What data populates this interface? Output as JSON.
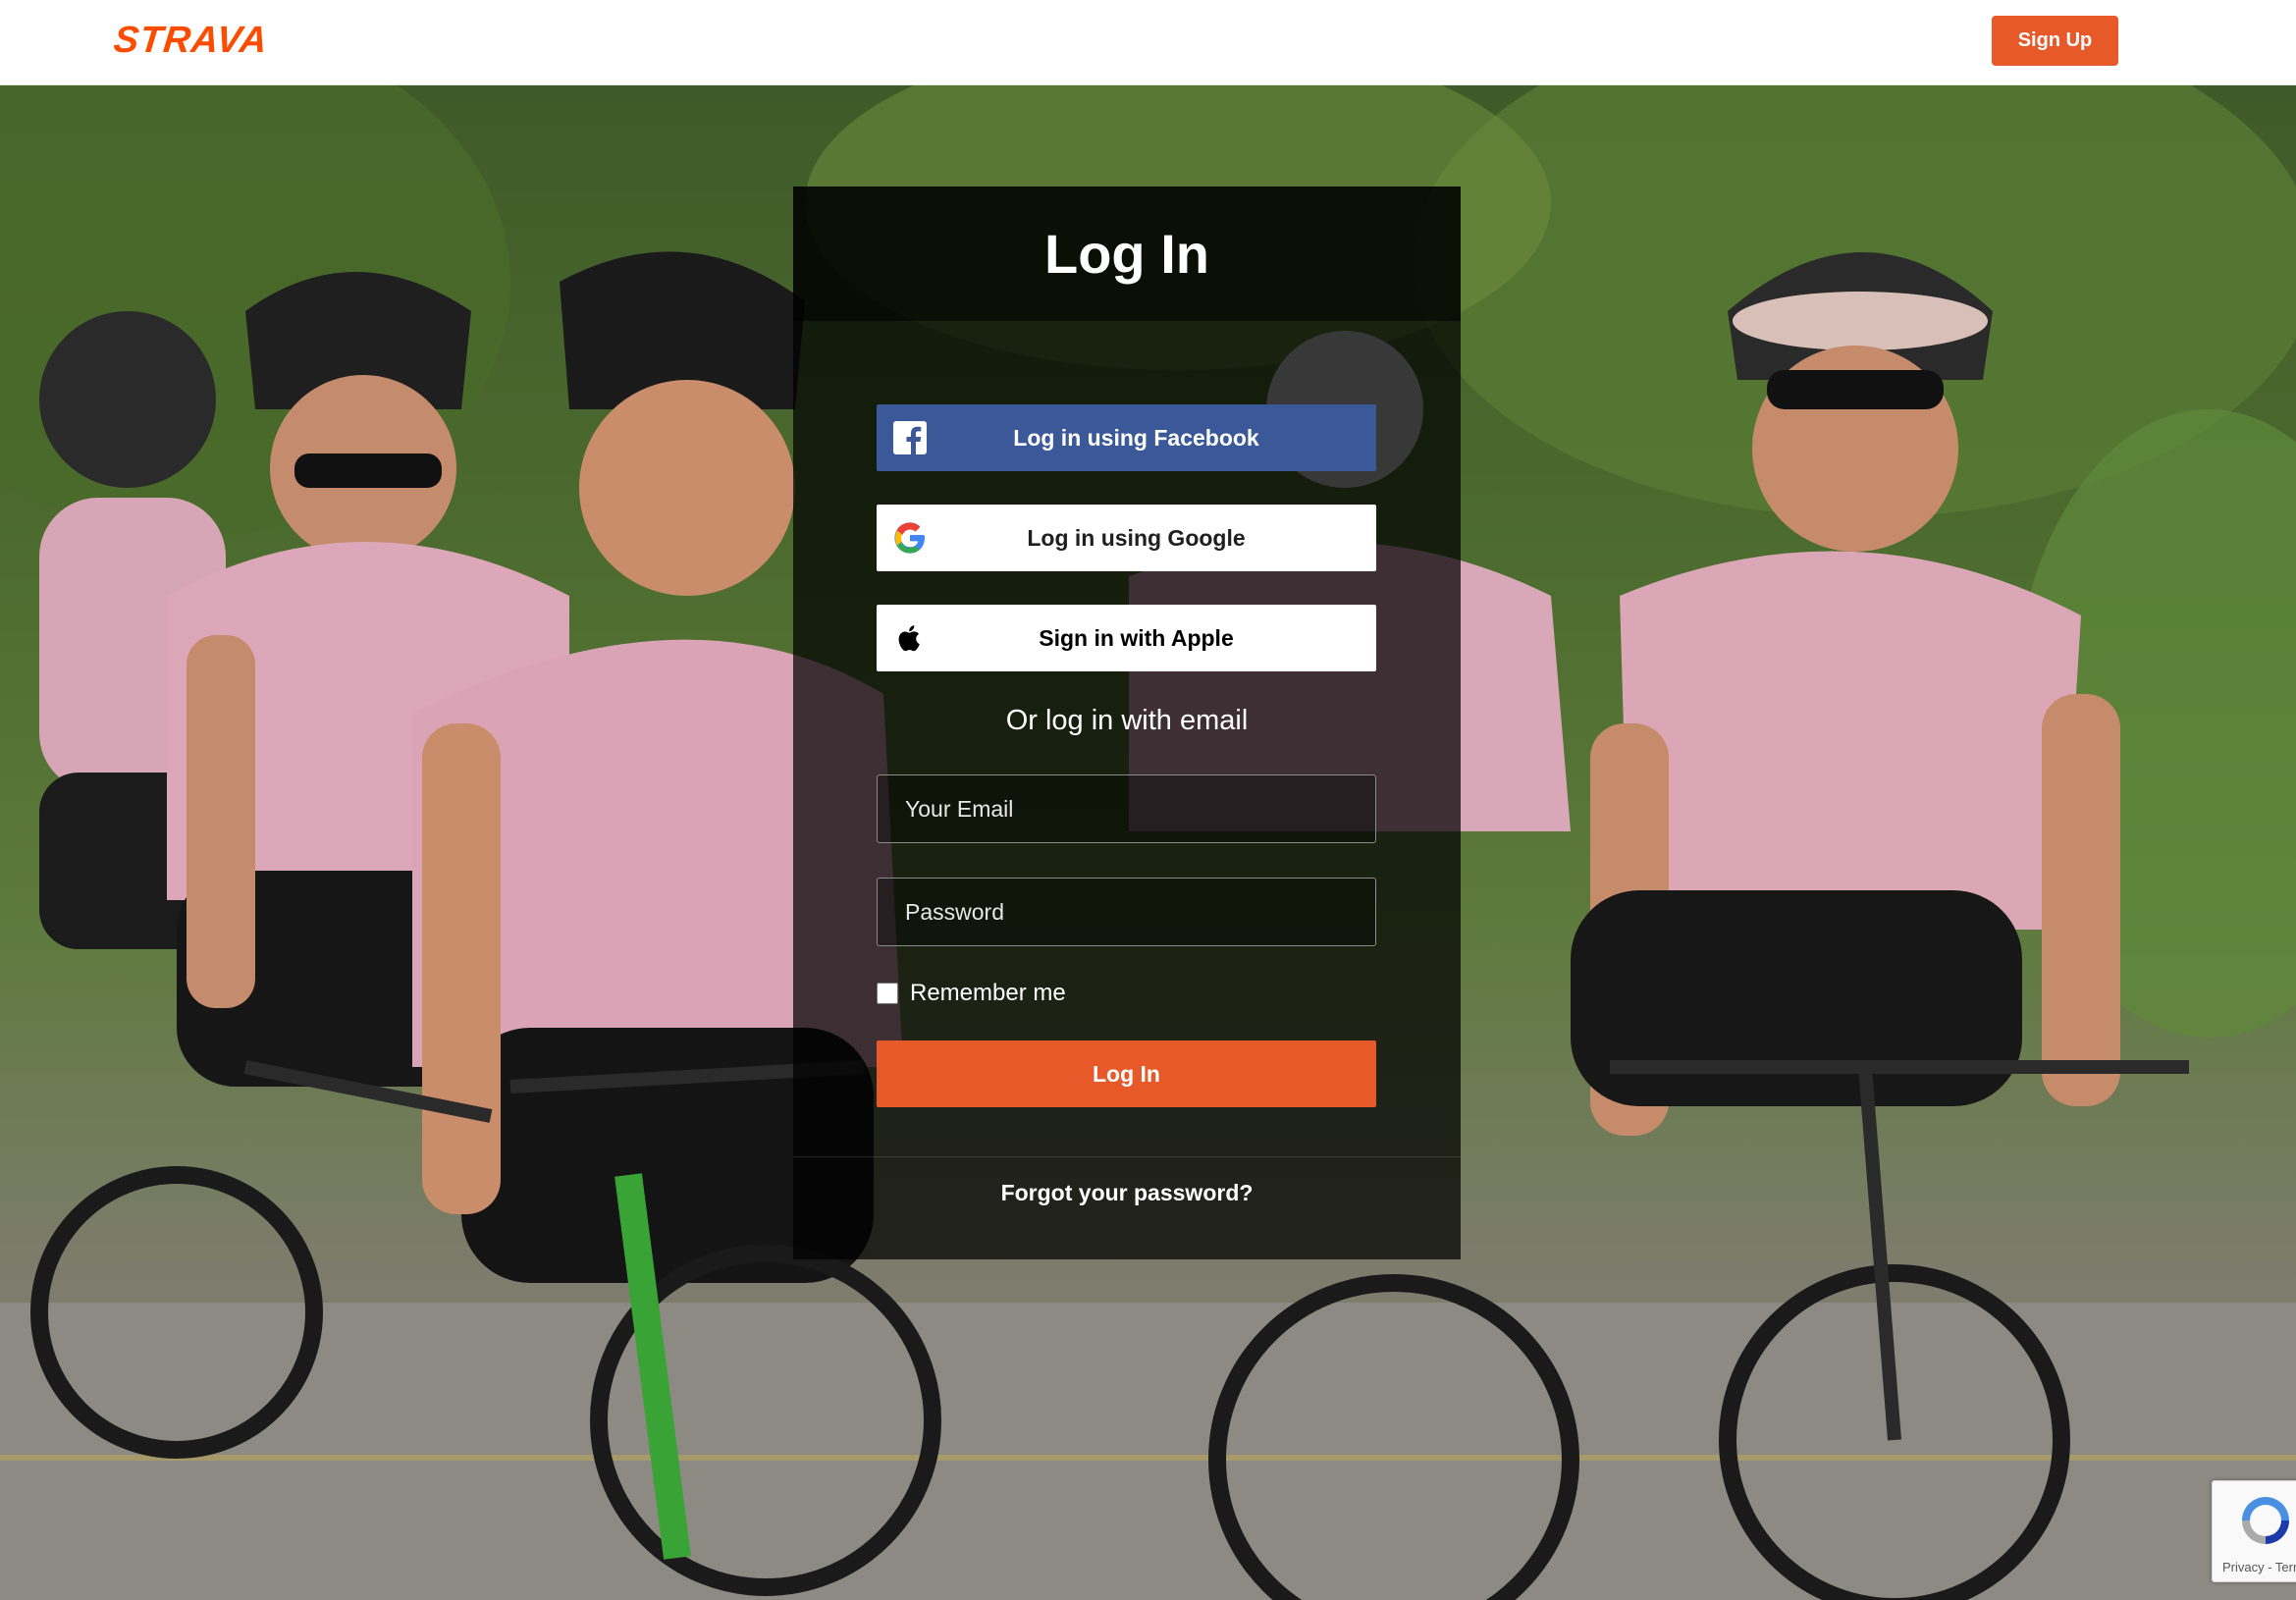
{
  "header": {
    "logo_text": "STRAVA",
    "signup_label": "Sign Up"
  },
  "login": {
    "title": "Log In",
    "facebook_label": "Log in using Facebook",
    "google_label": "Log in using Google",
    "apple_label": "Sign in with Apple",
    "or_email_text": "Or log in with email",
    "email_placeholder": "Your Email",
    "email_value": "",
    "password_placeholder": "Password",
    "password_value": "",
    "remember_label": "Remember me",
    "remember_checked": false,
    "submit_label": "Log In",
    "forgot_label": "Forgot your password?"
  },
  "recaptcha": {
    "links_text": "Privacy - Terms"
  },
  "icons": {
    "facebook": "facebook-icon",
    "google": "google-icon",
    "apple": "apple-icon",
    "recaptcha": "recaptcha-icon"
  },
  "colors": {
    "brand": "#fc4c02",
    "button_orange": "#e8592a",
    "facebook_blue": "#3b5998"
  }
}
